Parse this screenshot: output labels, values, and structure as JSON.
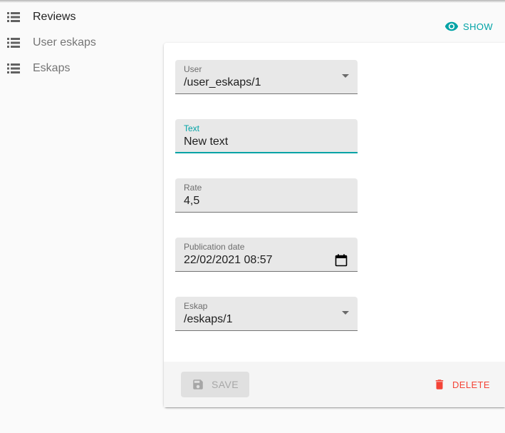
{
  "sidebar": {
    "items": [
      {
        "label": "Reviews",
        "icon": "list-icon",
        "active": true
      },
      {
        "label": "User eskaps",
        "icon": "list-icon",
        "active": false
      },
      {
        "label": "Eskaps",
        "icon": "list-icon",
        "active": false
      }
    ]
  },
  "actions": {
    "show_label": "SHOW",
    "show_icon": "eye-icon"
  },
  "form": {
    "user": {
      "label": "User",
      "value": "/user_eskaps/1"
    },
    "text": {
      "label": "Text",
      "value": "New text"
    },
    "rate": {
      "label": "Rate",
      "value": "4,5"
    },
    "publication_date": {
      "label": "Publication date",
      "value": "22/02/2021 08:57"
    },
    "eskap": {
      "label": "Eskap",
      "value": "/eskaps/1"
    }
  },
  "toolbar": {
    "save_label": "SAVE",
    "save_icon": "floppy-icon",
    "delete_label": "DELETE",
    "delete_icon": "trash-icon"
  },
  "colors": {
    "accent": "#00a3a6",
    "danger": "#f44336",
    "field_bg": "#e8e8e8"
  }
}
